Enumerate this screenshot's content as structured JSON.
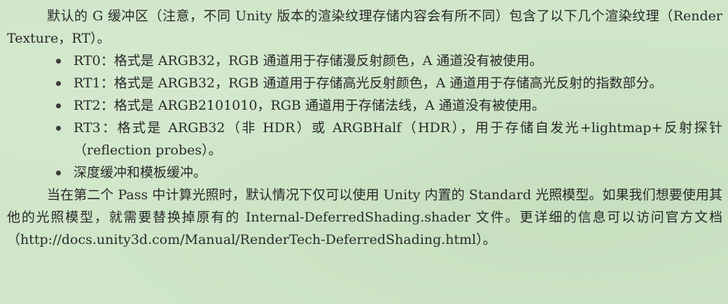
{
  "document": {
    "intro": "默认的 G 缓冲区（注意，不同 Unity 版本的渲染纹理存储内容会有所不同）包含了以下几个渲染纹理（Render Texture，RT）。",
    "bullets": [
      "RT0：格式是 ARGB32，RGB 通道用于存储漫反射颜色，A 通道没有被使用。",
      "RT1：格式是 ARGB32，RGB 通道用于存储高光反射颜色，A 通道用于存储高光反射的指数部分。",
      "RT2：格式是 ARGB2101010，RGB 通道用于存储法线，A 通道没有被使用。",
      "RT3：格式是 ARGB32（非 HDR）或 ARGBHalf（HDR），用于存储自发光+lightmap+反射探针（reflection probes）。",
      "深度缓冲和模板缓冲。"
    ],
    "outro": "当在第二个 Pass 中计算光照时，默认情况下仅可以使用 Unity 内置的 Standard 光照模型。如果我们想要使用其他的光照模型，就需要替换掉原有的 Internal-DeferredShading.shader 文件。更详细的信息可以访问官方文档（http://docs.unity3d.com/Manual/RenderTech-DeferredShading.html）。"
  },
  "colors": {
    "background": "#cfe6c8",
    "text": "#2a2a2a"
  }
}
